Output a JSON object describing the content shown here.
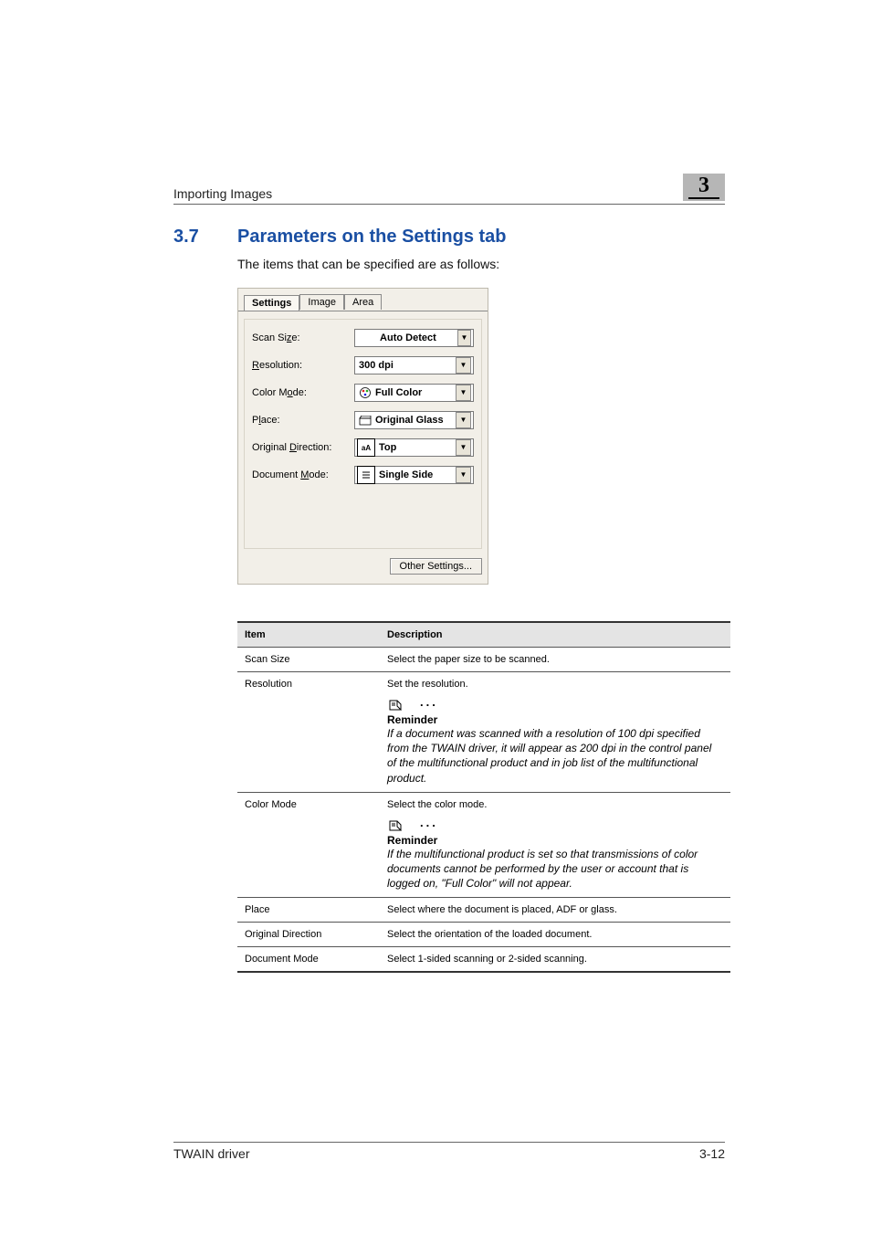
{
  "header": {
    "title": "Importing Images",
    "chapter": "3"
  },
  "section": {
    "number": "3.7",
    "title": "Parameters on the Settings tab",
    "intro": "The items that can be specified are as follows:"
  },
  "panel": {
    "tabs": [
      "Settings",
      "Image",
      "Area"
    ],
    "rows": {
      "scan_size": {
        "label_pre": "Scan Si",
        "label_u": "z",
        "label_post": "e:",
        "value": "Auto Detect"
      },
      "resolution": {
        "label_pre": "",
        "label_u": "R",
        "label_post": "esolution:",
        "value": "300 dpi"
      },
      "color_mode": {
        "label_pre": "Color M",
        "label_u": "o",
        "label_post": "de:",
        "value": "Full Color"
      },
      "place": {
        "label_pre": "P",
        "label_u": "l",
        "label_post": "ace:",
        "value": "Original Glass"
      },
      "orig_dir": {
        "label_pre": "Original ",
        "label_u": "D",
        "label_post": "irection:",
        "value": "Top"
      },
      "doc_mode": {
        "label_pre": "Document ",
        "label_u": "M",
        "label_post": "ode:",
        "value": "Single Side"
      }
    },
    "other_btn": "Other Settings..."
  },
  "icons": {
    "palette": "palette-icon",
    "glass": "glass-icon",
    "orientation": "orientation-icon",
    "single_side": "single-side-icon",
    "reminder": "reminder-icon",
    "dropdown": "▼"
  },
  "table": {
    "headers": {
      "item": "Item",
      "desc": "Description"
    },
    "rows": [
      {
        "item": "Scan Size",
        "desc": "Select the paper size to be scanned."
      },
      {
        "item": "Resolution",
        "desc": "Set the resolution.",
        "reminder": {
          "title": "Reminder",
          "body": "If a document was scanned with a resolution of 100 dpi specified from the TWAIN driver, it will appear as 200 dpi in the control panel of the multifunctional product and in job list of the multifunctional product."
        }
      },
      {
        "item": "Color Mode",
        "desc": "Select the color mode.",
        "reminder": {
          "title": "Reminder",
          "body": "If the multifunctional product is set so that transmissions of color documents cannot be performed by the user or account that is logged on, \"Full Color\" will not appear."
        }
      },
      {
        "item": "Place",
        "desc": "Select where the document is placed, ADF or glass."
      },
      {
        "item": "Original Direction",
        "desc": "Select the orientation of the loaded document."
      },
      {
        "item": "Document Mode",
        "desc": "Select 1-sided scanning or 2-sided scanning."
      }
    ]
  },
  "footer": {
    "left": "TWAIN driver",
    "right": "3-12"
  },
  "chart_data": {
    "type": "table",
    "columns": [
      "Item",
      "Description"
    ],
    "rows": [
      [
        "Scan Size",
        "Select the paper size to be scanned."
      ],
      [
        "Resolution",
        "Set the resolution. Reminder: If a document was scanned with a resolution of 100 dpi specified from the TWAIN driver, it will appear as 200 dpi in the control panel of the multifunctional product and in job list of the multifunctional product."
      ],
      [
        "Color Mode",
        "Select the color mode. Reminder: If the multifunctional product is set so that transmissions of color documents cannot be performed by the user or account that is logged on, \"Full Color\" will not appear."
      ],
      [
        "Place",
        "Select where the document is placed, ADF or glass."
      ],
      [
        "Original Direction",
        "Select the orientation of the loaded document."
      ],
      [
        "Document Mode",
        "Select 1-sided scanning or 2-sided scanning."
      ]
    ]
  }
}
